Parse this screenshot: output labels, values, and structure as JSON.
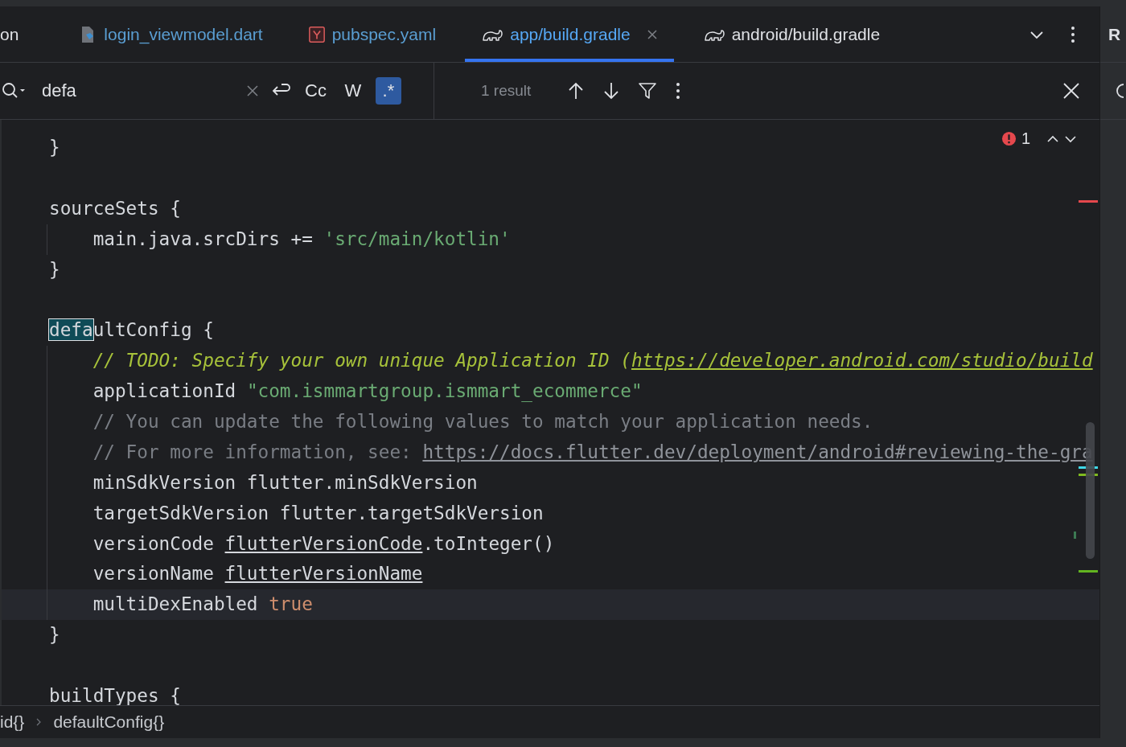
{
  "tabs": [
    {
      "label": "on",
      "kind": "plain",
      "modified": false,
      "selected": false,
      "closable": false
    },
    {
      "label": "login_viewmodel.dart",
      "kind": "dart",
      "modified": true,
      "selected": false,
      "closable": false
    },
    {
      "label": "pubspec.yaml",
      "kind": "yaml",
      "modified": true,
      "selected": false,
      "closable": false
    },
    {
      "label": "app/build.gradle",
      "kind": "gradle",
      "modified": true,
      "selected": true,
      "closable": true
    },
    {
      "label": "android/build.gradle",
      "kind": "gradle",
      "modified": false,
      "selected": false,
      "closable": false
    }
  ],
  "side_panel": {
    "label": "R"
  },
  "search": {
    "value": "defa",
    "options": [
      {
        "label": "Cc",
        "selected": false
      },
      {
        "label": "W",
        "selected": false
      },
      {
        "label": ".*",
        "selected": true
      }
    ],
    "results": "1 result"
  },
  "problems": {
    "count": "1"
  },
  "code_lines": [
    {
      "current": false,
      "guide": false,
      "tokens": [
        {
          "kind": "plain",
          "text": "}"
        }
      ]
    },
    {
      "current": false,
      "guide": false
    },
    {
      "current": false,
      "guide": false,
      "tokens": [
        {
          "kind": "plain",
          "text": "sourceSets {"
        }
      ]
    },
    {
      "current": false,
      "guide": true,
      "tokens": [
        {
          "kind": "plain",
          "text": "    main.java.srcDirs += "
        },
        {
          "kind": "string",
          "text": "'src/main/kotlin'"
        }
      ]
    },
    {
      "current": false,
      "guide": false,
      "tokens": [
        {
          "kind": "plain",
          "text": "}"
        }
      ]
    },
    {
      "current": false,
      "guide": false
    },
    {
      "current": false,
      "guide": false,
      "tokens": [
        {
          "kind": "match",
          "text": "defa"
        },
        {
          "kind": "plain",
          "text": "ultConfig {"
        }
      ]
    },
    {
      "current": false,
      "guide": true,
      "tokens": [
        {
          "kind": "todo",
          "text": "    // TODO: Specify your own unique Application ID ("
        },
        {
          "kind": "todo_link",
          "text": "https://developer.android.com/studio/build"
        }
      ]
    },
    {
      "current": false,
      "guide": true,
      "tokens": [
        {
          "kind": "plain",
          "text": "    applicationId "
        },
        {
          "kind": "string",
          "text": "\"com.ismmartgroup.ismmart_ecommerce\""
        }
      ]
    },
    {
      "current": false,
      "guide": true,
      "tokens": [
        {
          "kind": "comment",
          "text": "    // You can update the following values to match your application needs."
        }
      ]
    },
    {
      "current": false,
      "guide": true,
      "tokens": [
        {
          "kind": "comment",
          "text": "    // For more information, see: "
        },
        {
          "kind": "link",
          "text": "https://docs.flutter.dev/deployment/android#reviewing-the-gra"
        }
      ]
    },
    {
      "current": false,
      "guide": true,
      "tokens": [
        {
          "kind": "plain",
          "text": "    minSdkVersion flutter.minSdkVersion"
        }
      ]
    },
    {
      "current": false,
      "guide": true,
      "tokens": [
        {
          "kind": "plain",
          "text": "    targetSdkVersion flutter.targetSdkVersion"
        }
      ]
    },
    {
      "current": false,
      "guide": true,
      "tokens": [
        {
          "kind": "plain",
          "text": "    versionCode "
        },
        {
          "kind": "underlined",
          "text": "flutterVersionCode"
        },
        {
          "kind": "plain",
          "text": ".toInteger()"
        }
      ]
    },
    {
      "current": false,
      "guide": true,
      "tokens": [
        {
          "kind": "plain",
          "text": "    versionName "
        },
        {
          "kind": "underlined",
          "text": "flutterVersionName"
        }
      ]
    },
    {
      "current": true,
      "guide": true,
      "tokens": [
        {
          "kind": "plain",
          "text": "    multiDexEnabled "
        },
        {
          "kind": "keyword",
          "text": "true"
        }
      ]
    },
    {
      "current": false,
      "guide": false,
      "tokens": [
        {
          "kind": "plain",
          "text": "}"
        }
      ]
    },
    {
      "current": false,
      "guide": false
    },
    {
      "current": false,
      "guide": false,
      "tokens": [
        {
          "kind": "plain",
          "text": "buildTypes {"
        }
      ]
    }
  ],
  "breadcrumbs": [
    "id{}",
    "defaultConfig{}"
  ]
}
